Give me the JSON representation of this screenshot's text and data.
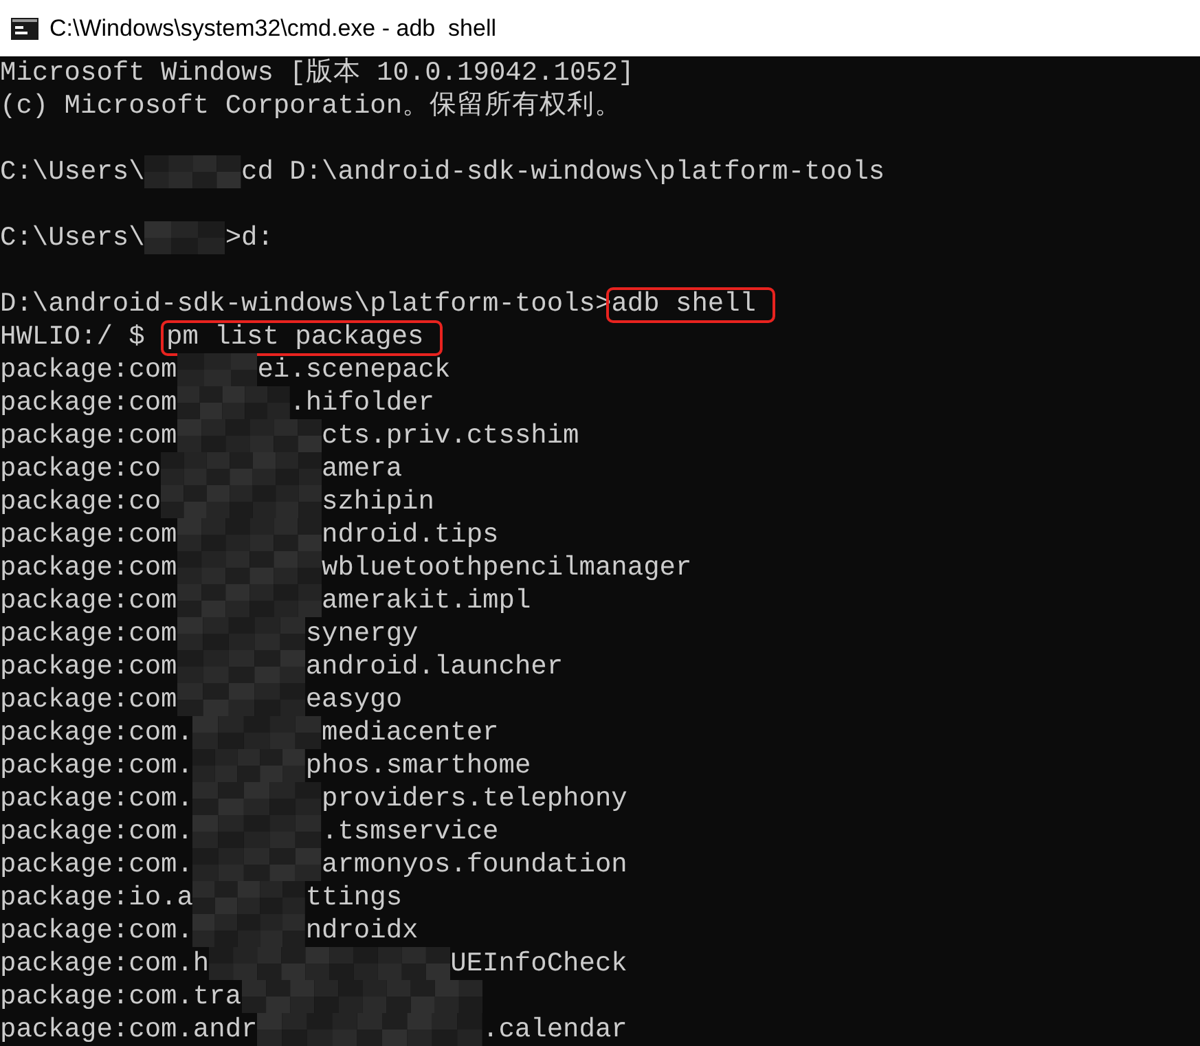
{
  "window": {
    "title": "C:\\Windows\\system32\\cmd.exe - adb  shell"
  },
  "console": {
    "lines": [
      {
        "kind": "text",
        "segments": [
          {
            "text": "Microsoft Windows [版本 10.0.19042.1052]",
            "highlighted": false
          }
        ]
      },
      {
        "kind": "text",
        "segments": [
          {
            "text": "(c) Microsoft Corporation。保留所有权利。",
            "highlighted": false
          }
        ]
      },
      {
        "kind": "blank"
      },
      {
        "kind": "text",
        "segments": [
          {
            "text": "C:\\Users\\",
            "highlighted": false
          },
          {
            "text": "cd D:\\android-sdk-windows\\platform-tools",
            "highlighted": false
          }
        ]
      },
      {
        "kind": "blank"
      },
      {
        "kind": "text",
        "segments": [
          {
            "text": "C:\\Users\\",
            "highlighted": false
          },
          {
            "text": ">d:",
            "highlighted": false
          }
        ]
      },
      {
        "kind": "blank"
      },
      {
        "kind": "text",
        "segments": [
          {
            "text": "D:\\android-sdk-windows\\platform-tools>",
            "highlighted": false
          },
          {
            "text": "adb shell",
            "highlighted": true
          }
        ]
      },
      {
        "kind": "text",
        "segments": [
          {
            "text": "HWLIO:/ $",
            "highlighted": false
          },
          {
            "text": "pm list packages",
            "highlighted": true
          }
        ]
      },
      {
        "kind": "text",
        "segments": [
          {
            "text": "package:com",
            "highlighted": false
          },
          {
            "text": "ei.scenepack",
            "highlighted": false
          }
        ]
      },
      {
        "kind": "text",
        "segments": [
          {
            "text": "package:com",
            "highlighted": false
          },
          {
            "text": ".hifolder",
            "highlighted": false
          }
        ]
      },
      {
        "kind": "text",
        "segments": [
          {
            "text": "package:com",
            "highlighted": false
          },
          {
            "text": "cts.priv.ctsshim",
            "highlighted": false
          }
        ]
      },
      {
        "kind": "text",
        "segments": [
          {
            "text": "package:co",
            "highlighted": false
          },
          {
            "text": "amera",
            "highlighted": false
          }
        ]
      },
      {
        "kind": "text",
        "segments": [
          {
            "text": "package:co",
            "highlighted": false
          },
          {
            "text": "szhipin",
            "highlighted": false
          }
        ]
      },
      {
        "kind": "text",
        "segments": [
          {
            "text": "package:com",
            "highlighted": false
          },
          {
            "text": "ndroid.tips",
            "highlighted": false
          }
        ]
      },
      {
        "kind": "text",
        "segments": [
          {
            "text": "package:com",
            "highlighted": false
          },
          {
            "text": "wbluetoothpencilmanager",
            "highlighted": false
          }
        ]
      },
      {
        "kind": "text",
        "segments": [
          {
            "text": "package:com",
            "highlighted": false
          },
          {
            "text": "amerakit.impl",
            "highlighted": false
          }
        ]
      },
      {
        "kind": "text",
        "segments": [
          {
            "text": "package:com",
            "highlighted": false
          },
          {
            "text": "synergy",
            "highlighted": false
          }
        ]
      },
      {
        "kind": "text",
        "segments": [
          {
            "text": "package:com",
            "highlighted": false
          },
          {
            "text": "android.launcher",
            "highlighted": false
          }
        ]
      },
      {
        "kind": "text",
        "segments": [
          {
            "text": "package:com",
            "highlighted": false
          },
          {
            "text": "easygo",
            "highlighted": false
          }
        ]
      },
      {
        "kind": "text",
        "segments": [
          {
            "text": "package:com.",
            "highlighted": false
          },
          {
            "text": "mediacenter",
            "highlighted": false
          }
        ]
      },
      {
        "kind": "text",
        "segments": [
          {
            "text": "package:com.",
            "highlighted": false
          },
          {
            "text": "phos.smarthome",
            "highlighted": false
          }
        ]
      },
      {
        "kind": "text",
        "segments": [
          {
            "text": "package:com.",
            "highlighted": false
          },
          {
            "text": "providers.telephony",
            "highlighted": false
          }
        ]
      },
      {
        "kind": "text",
        "segments": [
          {
            "text": "package:com.",
            "highlighted": false
          },
          {
            "text": ".tsmservice",
            "highlighted": false
          }
        ]
      },
      {
        "kind": "text",
        "segments": [
          {
            "text": "package:com.",
            "highlighted": false
          },
          {
            "text": "armonyos.foundation",
            "highlighted": false
          }
        ]
      },
      {
        "kind": "text",
        "segments": [
          {
            "text": "package:io.a",
            "highlighted": false
          },
          {
            "text": "ttings",
            "highlighted": false
          }
        ]
      },
      {
        "kind": "text",
        "segments": [
          {
            "text": "package:com.",
            "highlighted": false
          },
          {
            "text": "ndroidx",
            "highlighted": false
          }
        ]
      },
      {
        "kind": "text",
        "segments": [
          {
            "text": "package:com.h",
            "highlighted": false
          },
          {
            "text": "UEInfoCheck",
            "highlighted": false
          }
        ]
      },
      {
        "kind": "text",
        "segments": [
          {
            "text": "package:com.tra",
            "highlighted": false
          }
        ]
      },
      {
        "kind": "text",
        "segments": [
          {
            "text": "package:com.andr",
            "highlighted": false
          },
          {
            "text": ".calendar",
            "highlighted": false
          }
        ]
      }
    ]
  }
}
